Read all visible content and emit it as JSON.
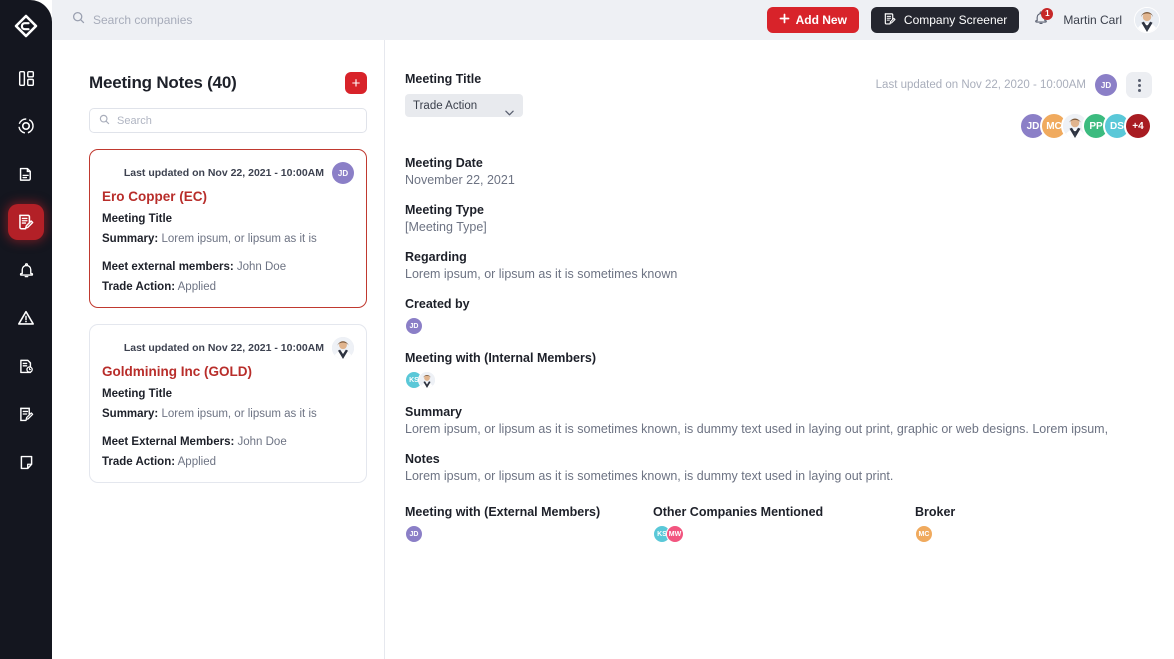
{
  "app": {
    "logo_icon": "brand-diamond-logo"
  },
  "topbar": {
    "search_placeholder": "Search companies",
    "search_value": "",
    "search_icon": "search-icon",
    "add_new_label": "Add New",
    "add_new_icon": "plus-icon",
    "screener_label": "Company Screener",
    "screener_icon": "document-screener-icon",
    "bell_icon": "bell-icon",
    "notification_count": "1",
    "user_name": "Martin Carl",
    "user_avatar_icon": "user-avatar"
  },
  "sidebar": {
    "items": [
      {
        "name": "dashboard",
        "icon": "dashboard-grid-icon",
        "active": false
      },
      {
        "name": "insights",
        "icon": "target-circle-icon",
        "active": false
      },
      {
        "name": "documents",
        "icon": "copy-documents-icon",
        "active": false
      },
      {
        "name": "meeting-notes",
        "icon": "note-edit-icon",
        "active": true
      },
      {
        "name": "alerts",
        "icon": "bell-alert-icon",
        "active": false
      },
      {
        "name": "risk",
        "icon": "warning-triangle-icon",
        "active": false
      },
      {
        "name": "reports",
        "icon": "report-clock-icon",
        "active": false
      },
      {
        "name": "tasks",
        "icon": "task-edit-icon",
        "active": false
      },
      {
        "name": "files",
        "icon": "file-page-icon",
        "active": false
      }
    ]
  },
  "list_panel": {
    "title": "Meeting Notes (40)",
    "add_icon": "plus-icon",
    "search_placeholder": "Search",
    "search_value": "",
    "search_icon": "search-icon",
    "cards": [
      {
        "updated": "Last updated on Nov 22, 2021 - 10:00AM",
        "avatar": {
          "initials": "JD",
          "color": "#8b7fc7",
          "type": "initials"
        },
        "company": "Ero Copper (EC)",
        "meeting_title": "Meeting Title",
        "summary_label": "Summary:",
        "summary_value": "Lorem ipsum, or lipsum as it is",
        "members_label": "Meet external members:",
        "members_value": "John Doe",
        "trade_label": "Trade Action:",
        "trade_value": "Applied",
        "selected": true
      },
      {
        "updated": "Last updated on Nov 22, 2021 - 10:00AM",
        "avatar": {
          "initials": "",
          "color": "#dfe3ea",
          "type": "photo"
        },
        "company": "Goldmining Inc (GOLD)",
        "meeting_title": "Meeting Title",
        "summary_label": "Summary:",
        "summary_value": "Lorem ipsum, or lipsum as it is",
        "members_label": "Meet External Members:",
        "members_value": "John Doe",
        "trade_label": "Trade Action:",
        "trade_value": "Applied",
        "selected": false
      }
    ]
  },
  "detail": {
    "meeting_title_label": "Meeting Title",
    "meeting_title_value": "Trade Action",
    "meeting_title_options": [
      "Trade Action"
    ],
    "chevron_icon": "chevron-down-icon",
    "last_updated": "Last updated on Nov 22, 2020 - 10:00AM",
    "last_updated_avatar": {
      "initials": "JD",
      "color": "#8b7fc7"
    },
    "kebab_icon": "more-vertical-icon",
    "participants": [
      {
        "initials": "JD",
        "color": "#8b7fc7",
        "type": "initials"
      },
      {
        "initials": "MC",
        "color": "#f0aa5e",
        "type": "initials"
      },
      {
        "initials": "",
        "color": "#e4e8ef",
        "type": "photo"
      },
      {
        "initials": "PP",
        "color": "#3cbb7f",
        "type": "initials"
      },
      {
        "initials": "DS",
        "color": "#5ac8d8",
        "type": "initials"
      },
      {
        "initials": "+4",
        "color": "#a81c22",
        "type": "initials"
      }
    ],
    "meeting_date_label": "Meeting Date",
    "meeting_date_value": "November 22, 2021",
    "meeting_type_label": "Meeting Type",
    "meeting_type_value": "[Meeting Type]",
    "regarding_label": "Regarding",
    "regarding_value": "Lorem ipsum, or lipsum as it is sometimes known",
    "created_by_label": "Created by",
    "created_by": [
      {
        "initials": "JD",
        "color": "#8b7fc7",
        "type": "initials"
      }
    ],
    "internal_label": "Meeting with (Internal Members)",
    "internal_members": [
      {
        "initials": "KS",
        "color": "#5ac8d8",
        "type": "initials"
      },
      {
        "initials": "",
        "color": "#e4e8ef",
        "type": "photo"
      }
    ],
    "summary_label": "Summary",
    "summary_value": "Lorem ipsum, or lipsum as it is sometimes known, is dummy text used in laying out print, graphic or web designs. Lorem ipsum,",
    "notes_label": "Notes",
    "notes_value": "Lorem ipsum, or lipsum as it is sometimes known, is dummy text used in laying out print.",
    "external_label": "Meeting with (External Members)",
    "external_members": [
      {
        "initials": "JD",
        "color": "#8b7fc7",
        "type": "initials"
      }
    ],
    "other_companies_label": "Other Companies Mentioned",
    "other_companies": [
      {
        "initials": "KS",
        "color": "#5ac8d8",
        "type": "initials"
      },
      {
        "initials": "MW",
        "color": "#f2557f",
        "type": "initials"
      }
    ],
    "broker_label": "Broker",
    "broker": [
      {
        "initials": "MC",
        "color": "#f0aa5e",
        "type": "initials"
      }
    ]
  },
  "colors": {
    "brand_red": "#d8232a",
    "sidebar_bg": "#14161f",
    "topbar_bg": "#eef0f4",
    "accent_dark": "#24262f",
    "company_red": "#b82d2a"
  }
}
